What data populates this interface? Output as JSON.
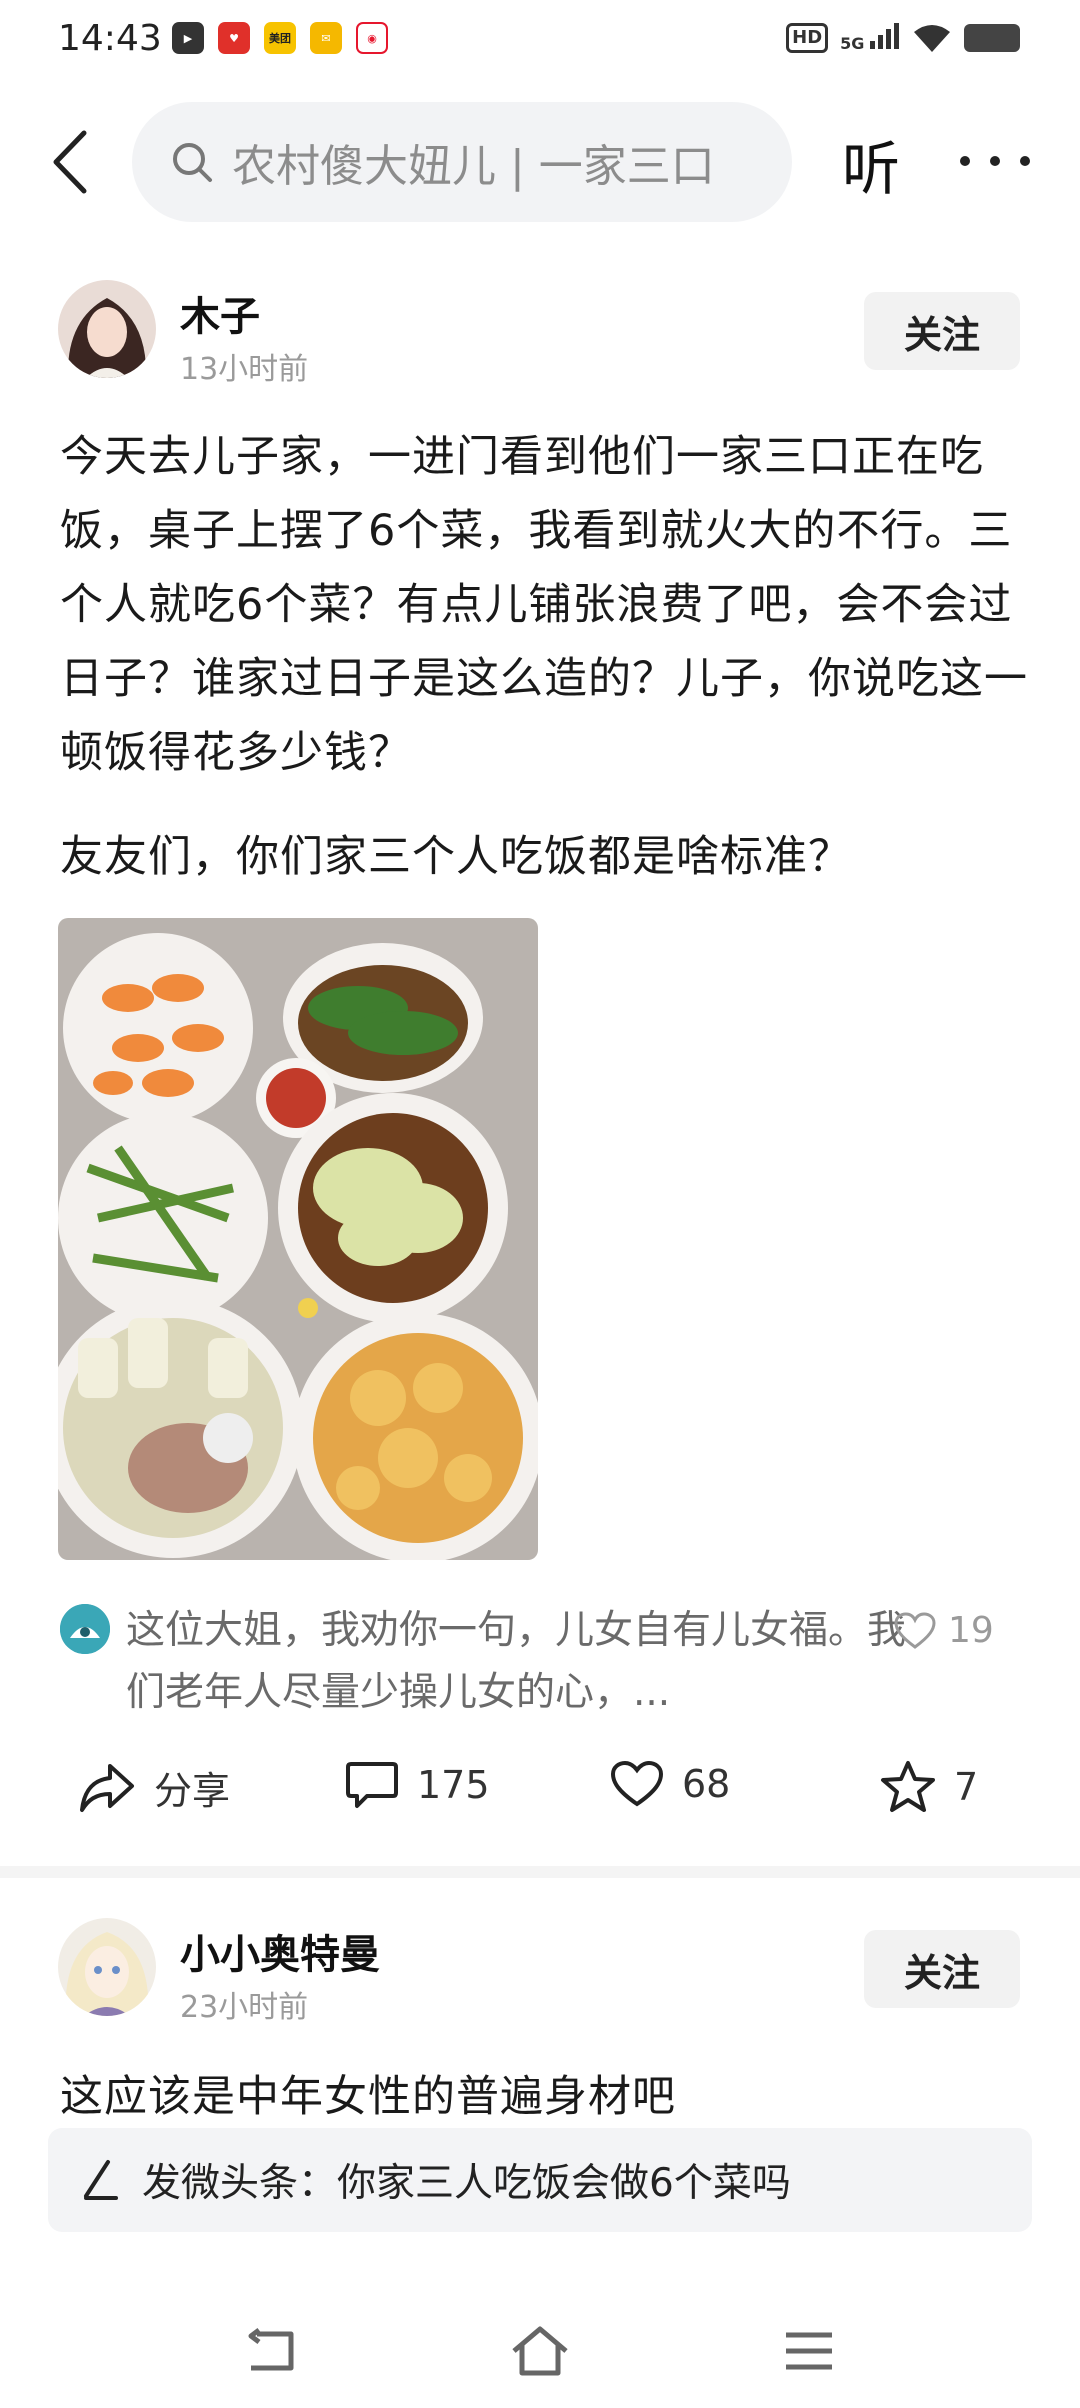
{
  "status_bar": {
    "time": "14:43",
    "app_icons": [
      "video-icon",
      "app-icon",
      "meituan-icon",
      "mail-icon",
      "weibo-icon"
    ],
    "app_badges": [
      "美团"
    ],
    "network": "5G",
    "hd": "HD"
  },
  "header": {
    "search_text": "农村傻大妞儿 | 一家三口",
    "listen_label": "听"
  },
  "post1": {
    "author": "木子",
    "time": "13小时前",
    "follow_label": "关注",
    "paragraph1": "今天去儿子家，一进门看到他们一家三口正在吃饭，桌子上摆了6个菜，我看到就火大的不行。三个人就吃6个菜？有点儿铺张浪费了吧，会不会过日子？谁家过日子是这么造的？儿子，你说吃这一顿饭得花多少钱？",
    "paragraph2": "友友们，你们家三个人吃饭都是啥标准？",
    "top_comment": {
      "text": "这位大姐，我劝你一句，儿女自有儿女福。我们老年人尽量少操儿女的心，...",
      "likes": "19"
    },
    "actions": {
      "share_label": "分享",
      "comments": "175",
      "likes": "68",
      "favorites": "7"
    }
  },
  "post2": {
    "author": "小小奥特曼",
    "time": "23小时前",
    "follow_label": "关注",
    "text": "这应该是中年女性的普遍身材吧"
  },
  "composer": {
    "label": "发微头条：你家三人吃饭会做6个菜吗"
  },
  "colors": {
    "accent_bg": "#f2f3f5",
    "text_primary": "#1a1a1a",
    "text_secondary": "#9a9a9a",
    "comment_avatar": "#3aa7b7"
  }
}
